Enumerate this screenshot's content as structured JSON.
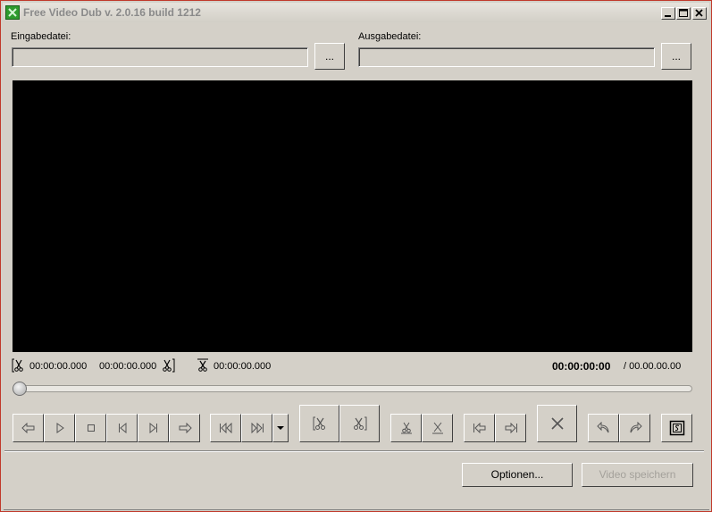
{
  "window": {
    "title": "Free Video Dub  v. 2.0.16 build 1212",
    "minimize_icon": "minimize-icon",
    "maximize_icon": "maximize-icon",
    "close_icon": "close-icon"
  },
  "input": {
    "label": "Eingabedatei:",
    "value": "",
    "browse_label": "..."
  },
  "output": {
    "label": "Ausgabedatei:",
    "value": "",
    "browse_label": "..."
  },
  "timecodes": {
    "selection_start": "00:00:00.000",
    "selection_end": "00:00:00.000",
    "selection_length": "00:00:00.000",
    "current": "00:00:00:00",
    "total": "/ 00.00.00.00"
  },
  "slider": {
    "position": 0
  },
  "toolbar": {
    "icons": [
      "step-back-icon",
      "play-icon",
      "stop-icon",
      "prev-frame-icon",
      "next-frame-icon",
      "step-forward-icon",
      "go-start-icon",
      "go-end-icon",
      "dropdown-arrow-icon",
      "mark-start-icon",
      "mark-end-icon",
      "select-scene-icon",
      "deselect-icon",
      "prev-mark-icon",
      "next-mark-icon",
      "delete-icon",
      "undo-icon",
      "redo-icon",
      "scene-detect-icon"
    ]
  },
  "actions": {
    "options_label": "Optionen...",
    "save_label": "Video speichern",
    "save_enabled": false
  }
}
